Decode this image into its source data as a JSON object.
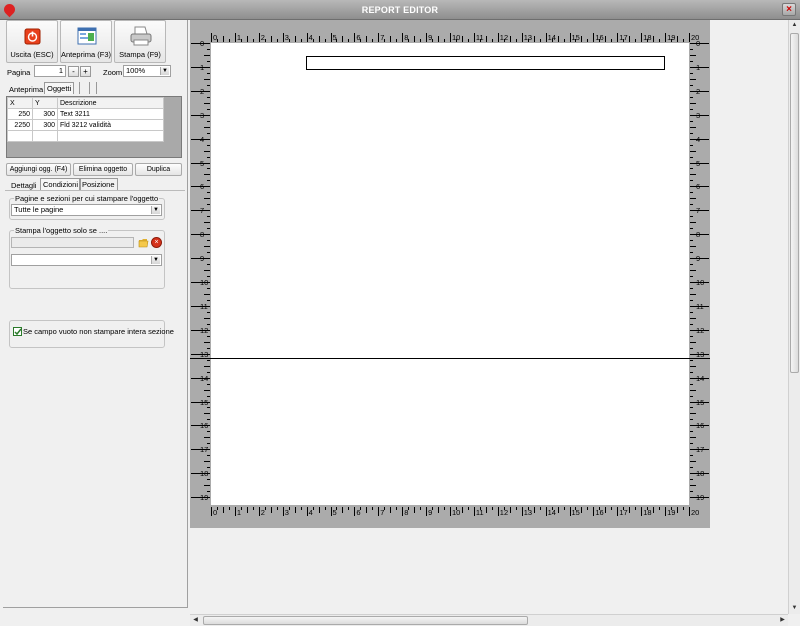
{
  "window": {
    "title": "REPORT EDITOR"
  },
  "toolbar": {
    "exit_label": "Uscita (ESC)",
    "preview_label": "Anteprima (F3)",
    "print_label": "Stampa (F9)"
  },
  "pager": {
    "page_label": "Pagina",
    "page_value": "1",
    "minus": "-",
    "plus": "+",
    "zoom_label": "Zoom",
    "zoom_value": "100%"
  },
  "top_tabs": [
    "Anteprima",
    "Oggetti",
    "",
    ""
  ],
  "objects_grid": {
    "columns": [
      "X",
      "Y",
      "Descrizione"
    ],
    "rows": [
      [
        "250",
        "300",
        "Text 3211"
      ],
      [
        "2250",
        "300",
        "Fld 3212 validità"
      ]
    ]
  },
  "object_buttons": {
    "add": "Aggiungi ogg. (F4)",
    "delete": "Elimina oggetto",
    "duplicate": "Duplica"
  },
  "detail_tabs": [
    "Dettagli",
    "Condizioni",
    "Posizione"
  ],
  "pages_group": {
    "caption": "Pagine e sezioni per cui stampare l'oggetto",
    "selected": "Tutte le pagine"
  },
  "condition_group": {
    "caption": "Stampa l'oggetto solo se ....",
    "field_value": "",
    "combo_value": ""
  },
  "empty_field_option": {
    "checked": true,
    "label": "Se campo vuoto non stampare intera sezione"
  },
  "ruler": {
    "horizontal": [
      "0",
      "1",
      "2",
      "3",
      "4",
      "5",
      "6",
      "7",
      "8",
      "9",
      "10",
      "11",
      "12",
      "13",
      "14",
      "15",
      "16",
      "17",
      "18",
      "19",
      "20"
    ],
    "vertical": [
      "0",
      "1",
      "2",
      "3",
      "4",
      "5",
      "6",
      "7",
      "8",
      "9",
      "10",
      "11",
      "12",
      "13",
      "14",
      "15",
      "16",
      "17",
      "18",
      "19"
    ]
  },
  "colors": {
    "titlebar": "#9e9e9e",
    "ruler": "#ababab",
    "page": "#ffffff",
    "checkbox": "#2a7a2a"
  }
}
